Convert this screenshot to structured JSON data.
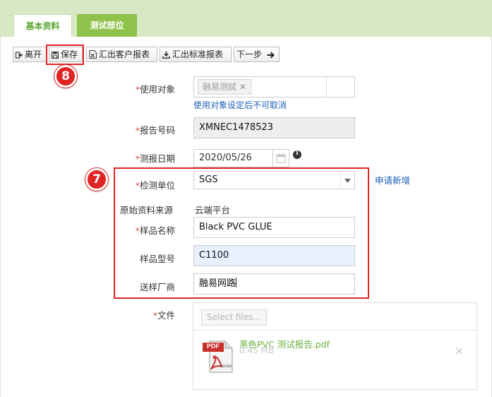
{
  "tabs": [
    {
      "label": "基本资料"
    },
    {
      "label": "测试部位"
    }
  ],
  "toolbar": {
    "leave": "离开",
    "save": "保存",
    "export_customer": "汇出客户报表",
    "export_standard": "汇出标准报表",
    "next": "下一步"
  },
  "form": {
    "target": {
      "label": "使用对象",
      "chip": "融易测試",
      "note": "使用对象设定后不可取消"
    },
    "report_no": {
      "label": "报告号码",
      "value": "XMNEC1478523"
    },
    "date": {
      "label": "测报日期",
      "value": "2020/05/26"
    },
    "unit": {
      "label": "检测单位",
      "value": "SGS",
      "apply_link": "申请新增"
    },
    "source": {
      "label": "原始资料来源",
      "value": "云端平台"
    },
    "sample_name": {
      "label": "样品名称",
      "value": "Black PVC GLUE"
    },
    "sample_model": {
      "label": "样品型号",
      "value": "C1100"
    },
    "supplier": {
      "label": "送样厂商",
      "value": "融易网路"
    },
    "file": {
      "label": "文件",
      "select_label": "Select files...",
      "name": "黑色PVC  测试报告.pdf",
      "size": "0.45 MB",
      "pdf_tag": "PDF",
      "pdf_vendor": "Adobe",
      "remove": "×"
    }
  },
  "required_mark": "*",
  "annotations": {
    "badge_save": "8",
    "badge_group": "7"
  },
  "colors": {
    "tab_bar": "#d8e8c5",
    "tab_active_text": "#5aa52f",
    "tab_inactive_bg": "#8fc24a",
    "callout": "#e02424",
    "link": "#1f5fb5",
    "file_link": "#6cb33e"
  }
}
